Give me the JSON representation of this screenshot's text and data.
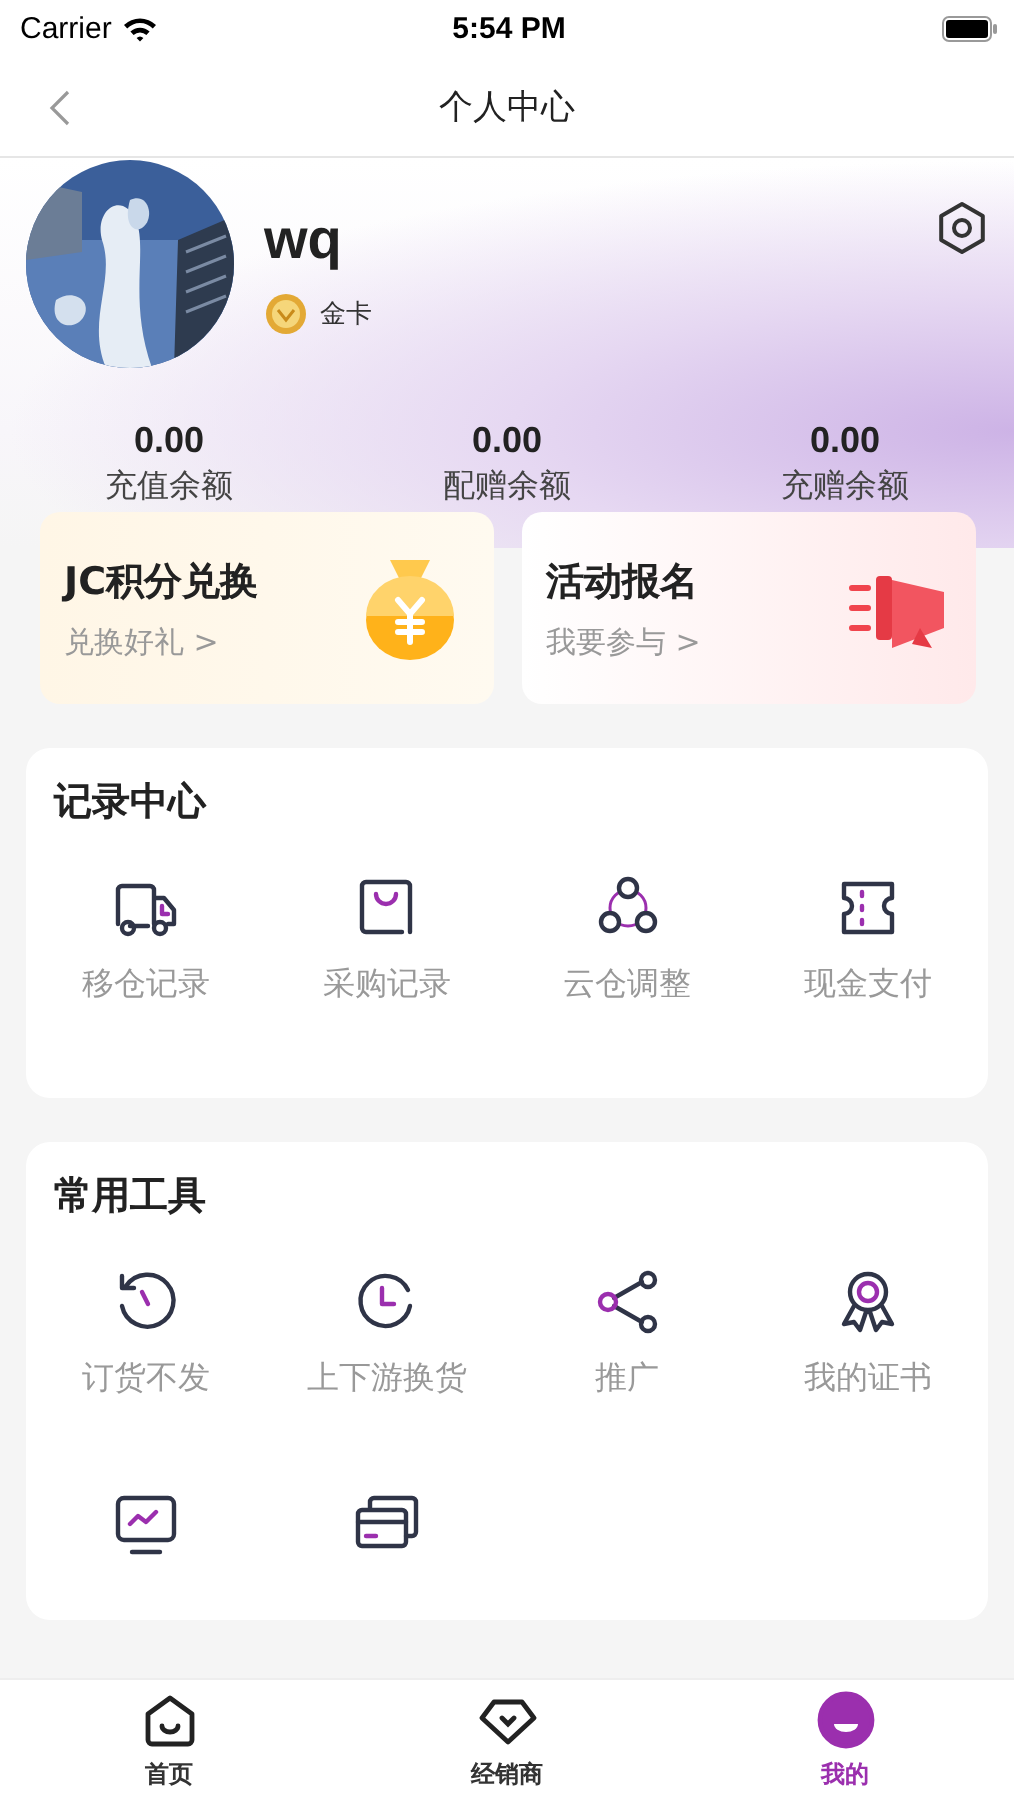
{
  "status_bar": {
    "carrier": "Carrier",
    "time": "5:54 PM"
  },
  "nav": {
    "title": "个人中心"
  },
  "profile": {
    "name": "wq",
    "level": "金卡"
  },
  "balances": [
    {
      "value": "0.00",
      "label": "充值余额"
    },
    {
      "value": "0.00",
      "label": "配赠余额"
    },
    {
      "value": "0.00",
      "label": "充赠余额"
    }
  ],
  "promos": [
    {
      "title": "JC积分兑换",
      "subtitle": "兑换好礼 >"
    },
    {
      "title": "活动报名",
      "subtitle": "我要参与 >"
    }
  ],
  "records": {
    "title": "记录中心",
    "items": [
      {
        "label": "移仓记录"
      },
      {
        "label": "采购记录"
      },
      {
        "label": "云仓调整"
      },
      {
        "label": "现金支付"
      }
    ]
  },
  "tools": {
    "title": "常用工具",
    "items": [
      {
        "label": "订货不发"
      },
      {
        "label": "上下游换货"
      },
      {
        "label": "推广"
      },
      {
        "label": "我的证书"
      },
      {
        "kind": "cut"
      },
      {
        "kind": "cut"
      }
    ]
  },
  "tab_bar": [
    {
      "label": "首页",
      "selected": false
    },
    {
      "label": "经销商",
      "selected": false
    },
    {
      "label": "我的",
      "selected": true
    }
  ]
}
